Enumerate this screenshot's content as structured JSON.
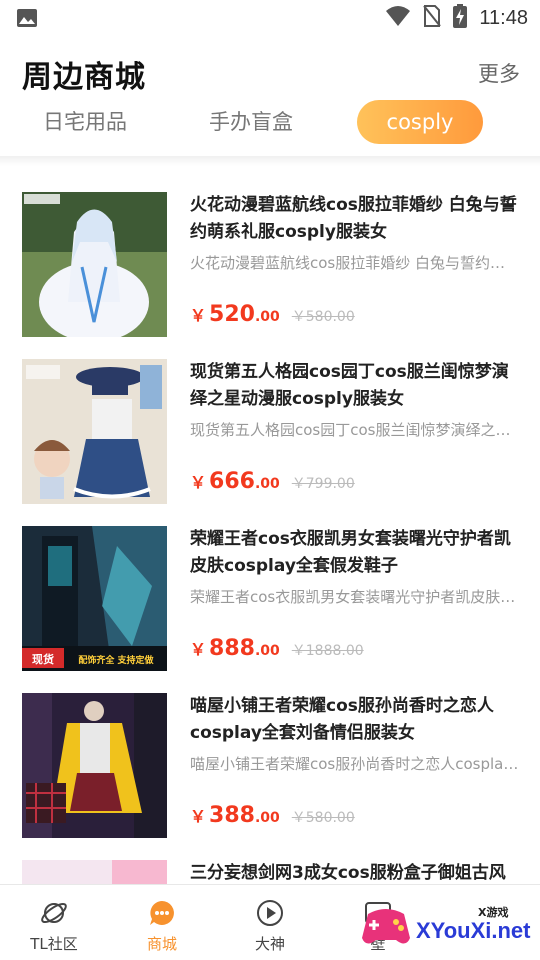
{
  "status_bar": {
    "time": "11:48"
  },
  "header": {
    "title": "周边商城",
    "more": "更多"
  },
  "tabs": [
    {
      "label": "日宅用品",
      "active": false
    },
    {
      "label": "手办盲盒",
      "active": false
    },
    {
      "label": "cosply",
      "active": true
    }
  ],
  "products": [
    {
      "title": "火花动漫碧蓝航线cos服拉菲婚纱 白兔与誓约萌系礼服cosply服装女",
      "desc": "火花动漫碧蓝航线cos服拉菲婚纱 白兔与誓约萌系礼服cosply服装女",
      "price_symbol": "￥",
      "price_int": "520",
      "price_dec": ".00",
      "price_old": "￥580.00"
    },
    {
      "title": "现货第五人格园cos园丁cos服兰闺惊梦演绎之星动漫服cosply服装女",
      "desc": "现货第五人格园cos园丁cos服兰闺惊梦演绎之星动漫服cosply服装女",
      "price_symbol": "￥",
      "price_int": "666",
      "price_dec": ".00",
      "price_old": "￥799.00"
    },
    {
      "title": "荣耀王者cos衣服凯男女套装曙光守护者凯皮肤cosplay全套假发鞋子",
      "desc": "荣耀王者cos衣服凯男女套装曙光守护者凯皮肤cosplay全套假发鞋子",
      "price_symbol": "￥",
      "price_int": "888",
      "price_dec": ".00",
      "price_old": "￥1888.00",
      "thumb_badge": "现货",
      "thumb_caption": "配饰齐全 支持定做"
    },
    {
      "title": "喵屋小铺王者荣耀cos服孙尚香时之恋人cosplay全套刘备情侣服装女",
      "desc": "喵屋小铺王者荣耀cos服孙尚香时之恋人cosplay全套刘备情侣服装女",
      "price_symbol": "￥",
      "price_int": "388",
      "price_dec": ".00",
      "price_old": "￥580.00"
    },
    {
      "title": "三分妄想剑网3成女cos服粉盒子御姐古风",
      "desc": "",
      "price_symbol": "",
      "price_int": "",
      "price_dec": "",
      "price_old": ""
    }
  ],
  "bottom_nav": [
    {
      "label": "TL社区",
      "icon": "planet-icon",
      "active": false
    },
    {
      "label": "商城",
      "icon": "chat-bubble-icon",
      "active": true
    },
    {
      "label": "大神",
      "icon": "play-circle-icon",
      "active": false
    },
    {
      "label": "壁",
      "icon": "image-icon",
      "active": false
    }
  ],
  "watermark": {
    "text": "XYouXi.net",
    "small": "X游戏"
  },
  "colors": {
    "accent": "#f7922e",
    "price": "#f2391e",
    "tab_gradient_start": "#ffc25a",
    "tab_gradient_end": "#ff9a3c"
  }
}
